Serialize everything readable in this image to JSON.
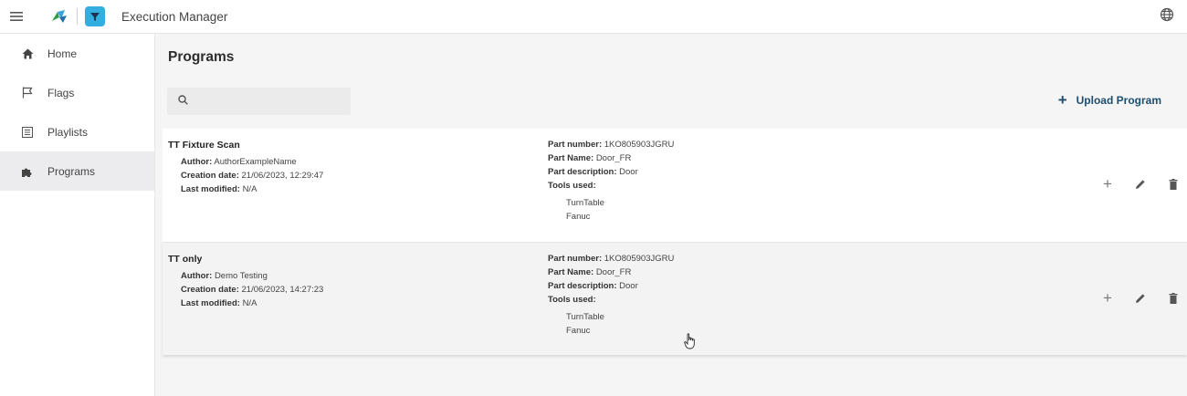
{
  "header": {
    "app_title": "Execution Manager",
    "menu_icon": "hamburger-menu-icon",
    "logo_icons": [
      "tribe-logo-icon",
      "filter-app-logo-icon"
    ],
    "language_icon": "globe-icon"
  },
  "sidebar": {
    "items": [
      {
        "label": "Home",
        "icon": "home-icon",
        "active": false
      },
      {
        "label": "Flags",
        "icon": "flag-icon",
        "active": false
      },
      {
        "label": "Playlists",
        "icon": "list-icon",
        "active": false
      },
      {
        "label": "Programs",
        "icon": "puzzle-icon",
        "active": true
      }
    ]
  },
  "main": {
    "title": "Programs",
    "search": {
      "placeholder": "",
      "value": ""
    },
    "upload_label": "Upload Program"
  },
  "labels": {
    "author": "Author:",
    "creation_date": "Creation date:",
    "last_modified": "Last modified:",
    "part_number": "Part number:",
    "part_name": "Part Name:",
    "part_description": "Part description:",
    "tools_used": "Tools used:"
  },
  "programs": [
    {
      "name": "TT Fixture Scan",
      "author": "AuthorExampleName",
      "creation_date": "21/06/2023, 12:29:47",
      "last_modified": "N/A",
      "part_number": "1KO805903JGRU",
      "part_name": "Door_FR",
      "part_description": "Door",
      "tools": [
        "TurnTable",
        "Fanuc"
      ]
    },
    {
      "name": "TT only",
      "author": "Demo Testing",
      "creation_date": "21/06/2023, 14:27:23",
      "last_modified": "N/A",
      "part_number": "1KO805903JGRU",
      "part_name": "Door_FR",
      "part_description": "Door",
      "tools": [
        "TurnTable",
        "Fanuc"
      ]
    }
  ],
  "colors": {
    "accent": "#1d4e6e",
    "logo_blue": "#33aee0",
    "active_bg": "#ececee"
  }
}
